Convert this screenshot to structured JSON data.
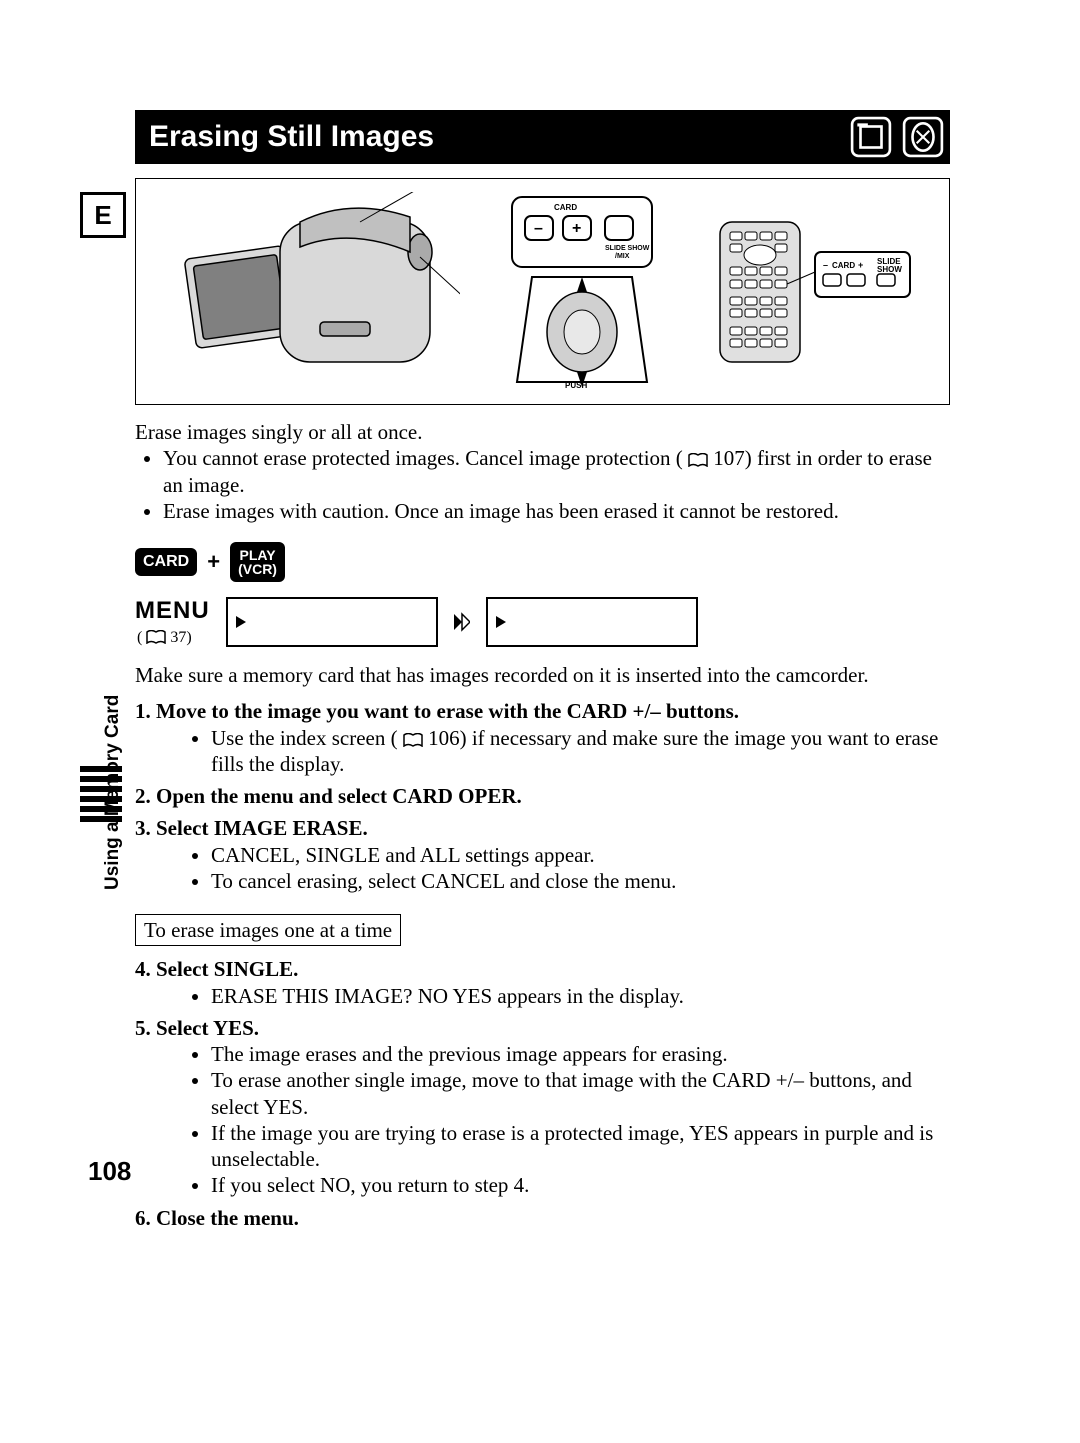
{
  "title": "Erasing Still Images",
  "language_marker": "E",
  "diagram": {
    "card_label": "CARD",
    "slideshow_label": "SLIDE SHOW",
    "mix_label": "/MIX",
    "push_label": "PUSH",
    "remote_card_minus": "–",
    "remote_card_label": "CARD",
    "remote_card_plus": "+",
    "remote_slide": "SLIDE",
    "remote_show": "SHOW"
  },
  "intro_line": "Erase images singly or all at once.",
  "intro_bullets": [
    "You cannot erase protected images. Cancel image protection (  107) first in order to erase an image.",
    "Erase images with caution. Once an image has been erased it cannot be restored."
  ],
  "intro_ref_page": "107",
  "mode": {
    "card": "CARD",
    "play": "PLAY",
    "vcr": "(VCR)",
    "plus": "+"
  },
  "menu": {
    "label": "MENU",
    "ref_page": "37"
  },
  "after_menu_paragraph": "Make sure a memory card that has images recorded on it is inserted into the camcorder.",
  "steps": [
    {
      "num": "1.",
      "title": "Move to the image you want to erase with the CARD +/– buttons.",
      "bullets": [
        "Use the index screen (  106) if necessary and make sure the image you want to erase fills the display."
      ],
      "ref_page": "106"
    },
    {
      "num": "2.",
      "title": "Open the menu and select CARD OPER.",
      "bullets": []
    },
    {
      "num": "3.",
      "title": "Select IMAGE ERASE.",
      "bullets": [
        "CANCEL, SINGLE and ALL settings appear.",
        "To cancel erasing, select CANCEL and close the menu."
      ]
    }
  ],
  "single_box": "To erase images one at a time",
  "steps_b": [
    {
      "num": "4.",
      "title": "Select SINGLE.",
      "bullets": [
        "ERASE THIS IMAGE? NO YES appears in the display."
      ]
    },
    {
      "num": "5.",
      "title": "Select YES.",
      "bullets": [
        "The image erases and the previous image appears for erasing.",
        "To erase another single image, move to that image with the CARD +/– buttons, and select YES.",
        "If the image you are trying to erase is a protected image, YES appears in purple and is unselectable.",
        "If you select NO, you return to step 4."
      ]
    },
    {
      "num": "6.",
      "title": "Close the menu.",
      "bullets": []
    }
  ],
  "side_label": "Using a Memory Card",
  "page_number": "108"
}
